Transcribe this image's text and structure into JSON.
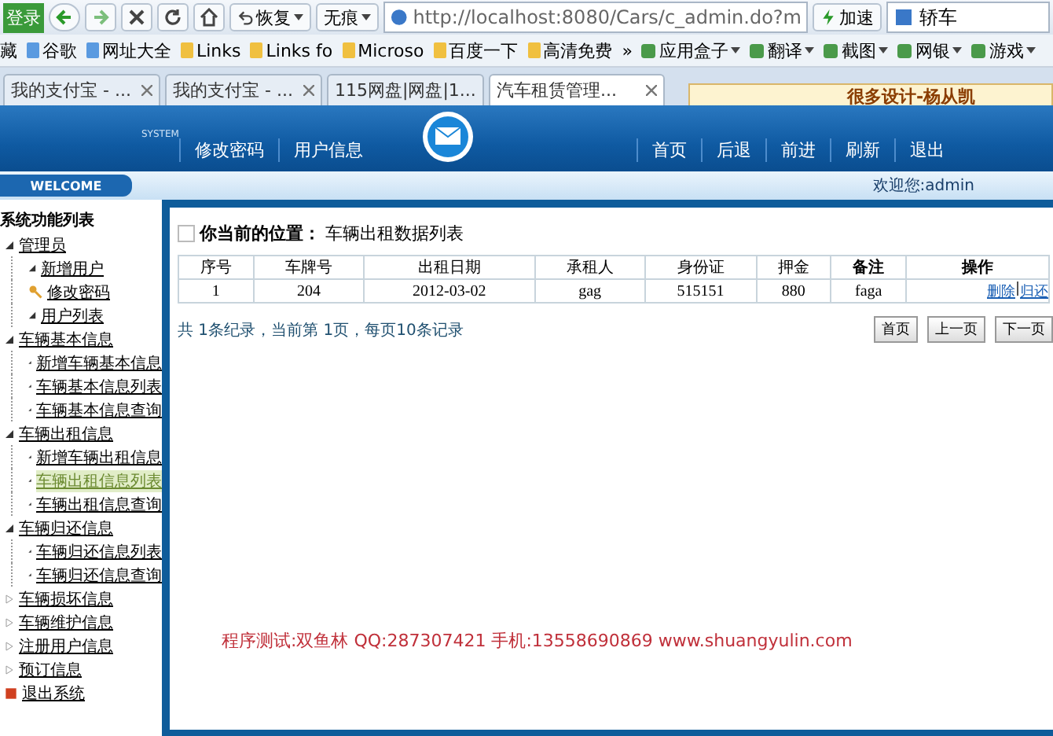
{
  "toolbar": {
    "login": "登录",
    "restore": "恢复",
    "incognito": "无痕",
    "address": "http://localhost:8080/Cars/c_admin.do?m",
    "accelerate": "加速",
    "search": "轿车"
  },
  "bookmarks": {
    "favorites": "藏",
    "items": [
      "谷歌",
      "网址大全",
      "Links",
      "Links fo",
      "Microso",
      "百度一下",
      "高清免费"
    ],
    "more": "»",
    "right_items": [
      "应用盒子",
      "翻译",
      "截图",
      "网银",
      "游戏"
    ]
  },
  "tabs": [
    {
      "label": "我的支付宝 - ...",
      "selected": false
    },
    {
      "label": "我的支付宝 - ...",
      "selected": false
    },
    {
      "label": "115网盘|网盘|1...",
      "selected": false
    },
    {
      "label": "汽车租赁管理...",
      "selected": true
    }
  ],
  "popup": {
    "text": "很多设计-杨从凯"
  },
  "header": {
    "system": "SYSTEM",
    "left_nav": [
      "修改密码",
      "用户信息"
    ],
    "right_nav": [
      "首页",
      "后退",
      "前进",
      "刷新",
      "退出"
    ]
  },
  "welcome": {
    "label": "WELCOME",
    "user": "欢迎您:admin"
  },
  "sidebar": {
    "title": "系统功能列表",
    "items": [
      {
        "label": "管理员",
        "expanded": true,
        "selected": false,
        "children": [
          {
            "label": "新增用户",
            "selected": false
          },
          {
            "label": "修改密码",
            "selected": false,
            "kind": "key"
          },
          {
            "label": "用户列表",
            "selected": false
          }
        ]
      },
      {
        "label": "车辆基本信息",
        "expanded": true,
        "selected": false,
        "children": [
          {
            "label": "新增车辆基本信息",
            "selected": false
          },
          {
            "label": "车辆基本信息列表",
            "selected": false
          },
          {
            "label": "车辆基本信息查询",
            "selected": false
          }
        ]
      },
      {
        "label": "车辆出租信息",
        "expanded": true,
        "selected": false,
        "children": [
          {
            "label": "新增车辆出租信息",
            "selected": false
          },
          {
            "label": "车辆出租信息列表",
            "selected": true
          },
          {
            "label": "车辆出租信息查询",
            "selected": false
          }
        ]
      },
      {
        "label": "车辆归还信息",
        "expanded": true,
        "selected": false,
        "children": [
          {
            "label": "车辆归还信息列表",
            "selected": false
          },
          {
            "label": "车辆归还信息查询",
            "selected": false
          }
        ]
      },
      {
        "label": "车辆损坏信息",
        "expanded": false,
        "selected": false
      },
      {
        "label": "车辆维护信息",
        "expanded": false,
        "selected": false
      },
      {
        "label": "注册用户信息",
        "expanded": false,
        "selected": false
      },
      {
        "label": "预订信息",
        "expanded": false,
        "selected": false
      },
      {
        "label": "退出系统",
        "kind": "exit",
        "selected": false
      }
    ]
  },
  "breadcrumb": {
    "checked": false,
    "label": "你当前的位置：",
    "value": "车辆出租数据列表"
  },
  "table": {
    "columns": [
      "序号",
      "车牌号",
      "出租日期",
      "承租人",
      "身份证",
      "押金",
      "备注",
      "操作"
    ],
    "rows": [
      {
        "cells": [
          "1",
          "204",
          "2012-03-02",
          "gag",
          "515151",
          "880",
          "faga"
        ],
        "actions": [
          "删除",
          "归还"
        ]
      }
    ]
  },
  "pagination": {
    "summary": "共 1条纪录，当前第 1页，每页10条记录",
    "buttons": [
      "首页",
      "上一页",
      "下一页"
    ]
  },
  "footer": "程序测试:双鱼林 QQ:287307421 手机:13558690869 www.shuangyulin.com"
}
